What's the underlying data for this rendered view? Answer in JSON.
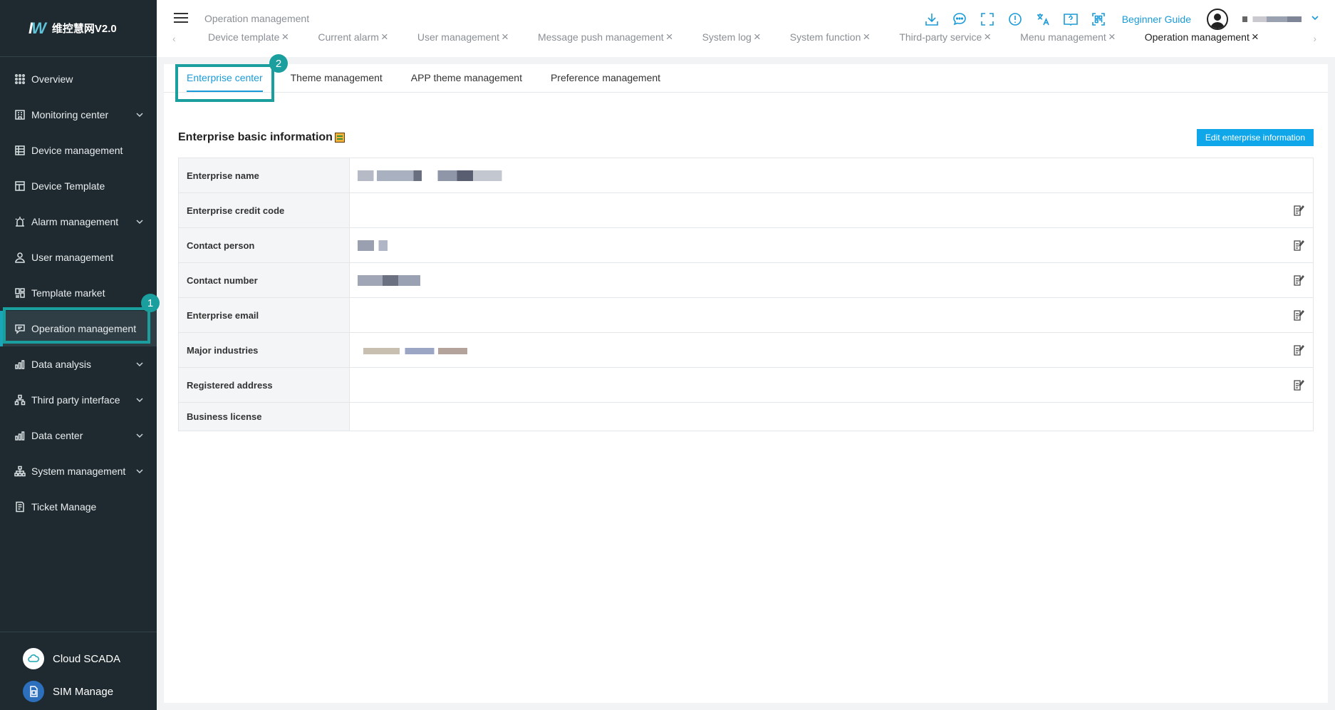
{
  "app": {
    "logo_text": "维控慧网V2.0"
  },
  "sidebar": {
    "items": [
      {
        "label": "Overview",
        "icon": "grid-icon",
        "expandable": false
      },
      {
        "label": "Monitoring center",
        "icon": "building-icon",
        "expandable": true
      },
      {
        "label": "Device management",
        "icon": "device-list-icon",
        "expandable": false
      },
      {
        "label": "Device Template",
        "icon": "template-icon",
        "expandable": false
      },
      {
        "label": "Alarm management",
        "icon": "alarm-light-icon",
        "expandable": true
      },
      {
        "label": "User management",
        "icon": "user-icon",
        "expandable": false
      },
      {
        "label": "Template market",
        "icon": "market-icon",
        "expandable": false
      },
      {
        "label": "Operation management",
        "icon": "chat-card-icon",
        "expandable": false,
        "active": true
      },
      {
        "label": "Data analysis",
        "icon": "bar-chart-icon",
        "expandable": true
      },
      {
        "label": "Third party interface",
        "icon": "network-icon",
        "expandable": true
      },
      {
        "label": "Data center",
        "icon": "bar-chart-icon",
        "expandable": true
      },
      {
        "label": "System management",
        "icon": "org-chart-icon",
        "expandable": true
      },
      {
        "label": "Ticket Manage",
        "icon": "ticket-icon",
        "expandable": false
      }
    ],
    "bottom": [
      {
        "label": "Cloud SCADA",
        "icon": "cloud-icon"
      },
      {
        "label": "SIM Manage",
        "icon": "sim-card-icon"
      }
    ]
  },
  "annotations": {
    "step1": "1",
    "step2": "2"
  },
  "header": {
    "breadcrumb": "Operation management",
    "beginner_guide": "Beginner Guide",
    "icons": [
      "download-icon",
      "message-icon",
      "fullscreen-icon",
      "alert-icon",
      "translate-icon",
      "help-book-icon",
      "qr-scan-icon"
    ],
    "tab_prev": "‹",
    "tab_next": "›",
    "tab_close": "×",
    "tabs": [
      {
        "label": "Device template"
      },
      {
        "label": "Current alarm"
      },
      {
        "label": "User management"
      },
      {
        "label": "Message push management"
      },
      {
        "label": "System log"
      },
      {
        "label": "System function"
      },
      {
        "label": "Third-party service"
      },
      {
        "label": "Menu management"
      },
      {
        "label": "Operation management",
        "active": true
      }
    ]
  },
  "content": {
    "sub_tabs": [
      {
        "label": "Enterprise center",
        "active": true
      },
      {
        "label": "Theme management"
      },
      {
        "label": "APP theme management"
      },
      {
        "label": "Preference management"
      }
    ],
    "section_title": "Enterprise basic information",
    "edit_button": "Edit enterprise information",
    "fields": [
      {
        "label": "Enterprise name",
        "editable": false
      },
      {
        "label": "Enterprise credit code",
        "editable": true
      },
      {
        "label": "Contact person",
        "editable": true
      },
      {
        "label": "Contact number",
        "editable": true
      },
      {
        "label": "Enterprise email",
        "editable": true
      },
      {
        "label": "Major industries",
        "editable": true
      },
      {
        "label": "Registered address",
        "editable": true
      },
      {
        "label": "Business license",
        "editable": false
      }
    ]
  }
}
